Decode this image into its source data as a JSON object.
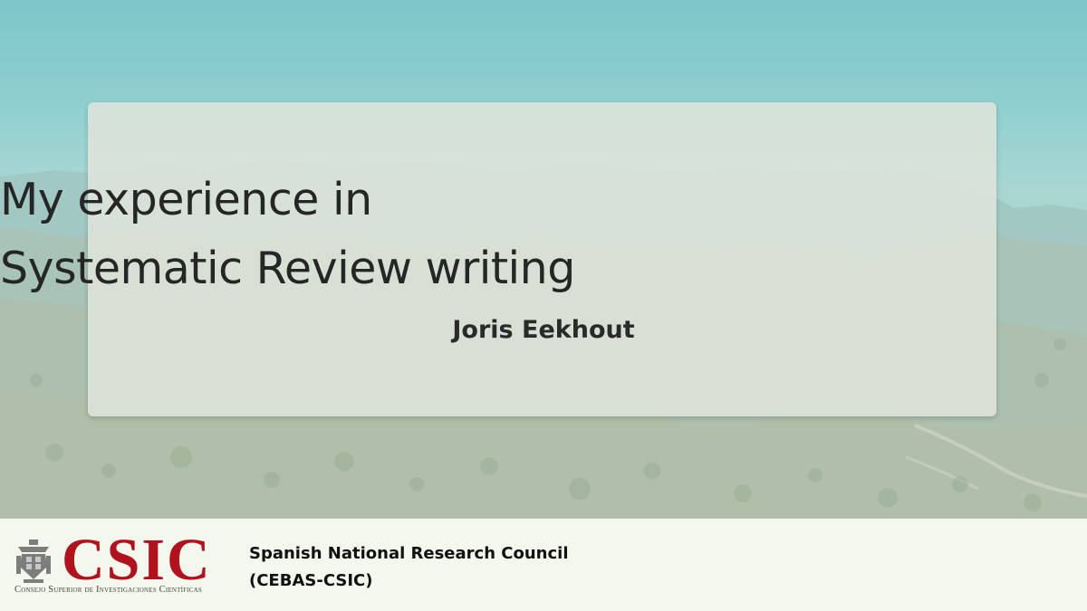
{
  "slide": {
    "title_line1": "My experience in",
    "title_line2": "Systematic Review writing",
    "author": "Joris Eekhout"
  },
  "footer": {
    "logo_text": "CSIC",
    "logo_subtitle": "Consejo Superior de Investigaciones Científicas",
    "logo_emblem_icon": "csic-emblem-icon",
    "org_line1": "Spanish National Research Council",
    "org_line2": "(CEBAS-CSIC)"
  },
  "colors": {
    "logo_red": "#b0131d",
    "card_bg": "#dee4da",
    "footer_bg": "#f4f7ee",
    "sky": "#7ec6c9"
  }
}
